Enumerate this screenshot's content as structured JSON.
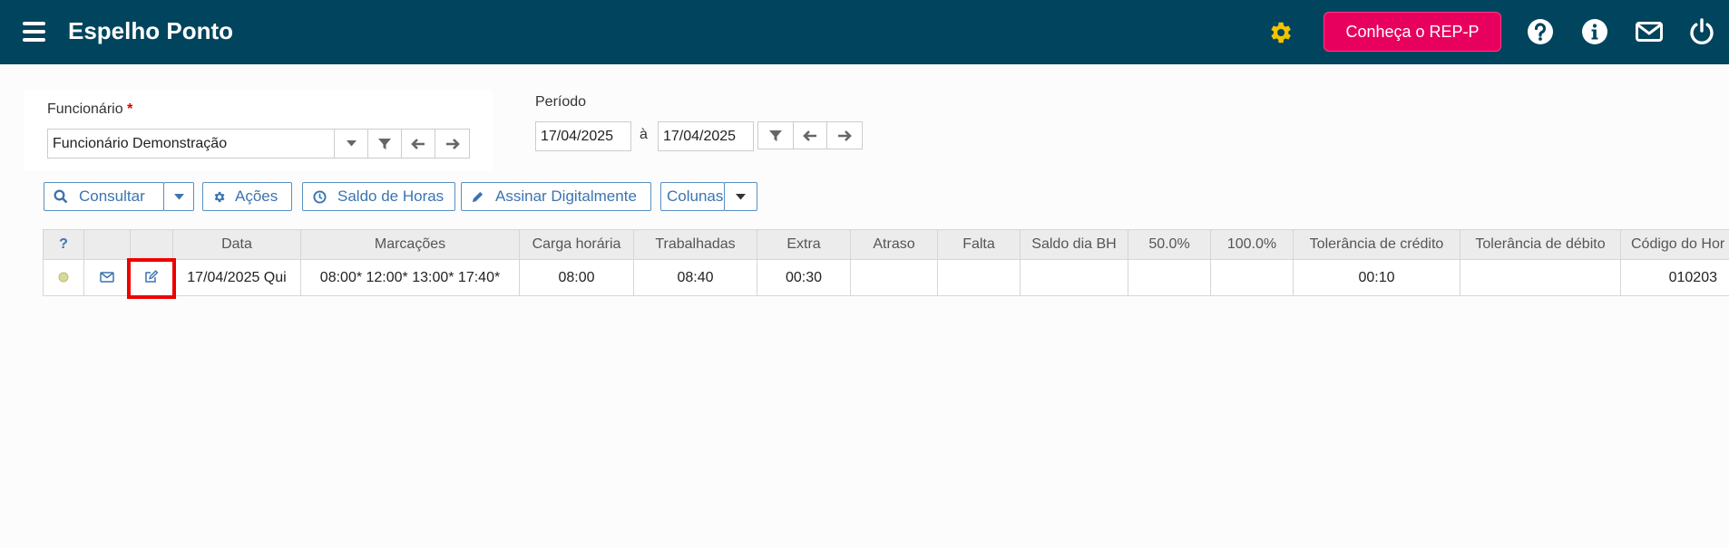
{
  "header": {
    "title": "Espelho Ponto",
    "rep_button": "Conheça o REP-P",
    "icons": [
      "menu-icon",
      "gear-icon",
      "help-icon",
      "info-icon",
      "mail-icon",
      "power-icon"
    ],
    "bg_color": "#00445e",
    "accent_color": "#e8005f",
    "gear_color": "#f2c300"
  },
  "filters": {
    "employee_label": "Funcionário",
    "required_mark": "*",
    "employee_value": "Funcionário Demonstração",
    "period_label": "Período",
    "date_from": "17/04/2025",
    "date_sep": "à",
    "date_to": "17/04/2025"
  },
  "toolbar": {
    "consultar": "Consultar",
    "acoes": "Ações",
    "saldo": "Saldo de Horas",
    "assinar": "Assinar Digitalmente",
    "colunas": "Colunas"
  },
  "table": {
    "headers": {
      "help": "?",
      "data": "Data",
      "marcacoes": "Marcações",
      "carga": "Carga horária",
      "trabalhadas": "Trabalhadas",
      "extra": "Extra",
      "atraso": "Atraso",
      "falta": "Falta",
      "saldo_bh": "Saldo dia BH",
      "p50": "50.0%",
      "p100": "100.0%",
      "tol_cred": "Tolerância de crédito",
      "tol_deb": "Tolerância de débito",
      "codigo": "Código do Hor"
    },
    "row": {
      "status_color": "#d8d89a",
      "data": "17/04/2025 Qui",
      "marcacoes": "08:00* 12:00* 13:00* 17:40*",
      "carga": "08:00",
      "trabalhadas": "08:40",
      "extra": "00:30",
      "atraso": "",
      "falta": "",
      "saldo_bh": "",
      "p50": "",
      "p100": "",
      "tol_cred": "00:10",
      "tol_deb": "",
      "codigo": "010203"
    }
  }
}
